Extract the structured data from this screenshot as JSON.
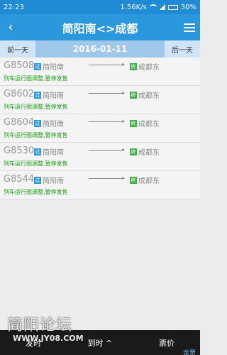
{
  "status": {
    "time": "22:23",
    "speed": "1.56K/s",
    "battery": "30%"
  },
  "header": {
    "title": "简阳南<>成都",
    "back_icon": "‹"
  },
  "date_bar": {
    "prev_label": "前一天",
    "date": "2016-01-11",
    "next_label": "后一天"
  },
  "trains": [
    {
      "code": "G8508",
      "from_badge": "过",
      "from": "简阳南",
      "to_badge": "终",
      "to": "成都东",
      "notice": "列车运行图调整,暂停发售"
    },
    {
      "code": "G8602",
      "from_badge": "过",
      "from": "简阳南",
      "to_badge": "终",
      "to": "成都东",
      "notice": "列车运行图调整,暂停发售"
    },
    {
      "code": "G8604",
      "from_badge": "过",
      "from": "简阳南",
      "to_badge": "终",
      "to": "成都东",
      "notice": "列车运行图调整,暂停发售"
    },
    {
      "code": "G8530",
      "from_badge": "过",
      "from": "简阳南",
      "to_badge": "终",
      "to": "成都东",
      "notice": "列车运行图调整,暂停发售"
    },
    {
      "code": "G8544",
      "from_badge": "过",
      "from": "简阳南",
      "to_badge": "终",
      "to": "成都东",
      "notice": "列车运行图调整,暂停发售"
    }
  ],
  "bottom": {
    "depart": "发时",
    "arrive": "到时 ^",
    "price": "票价",
    "remaining": "余票"
  },
  "watermark": {
    "text": "简阳论坛",
    "url": "WWW.JY08.COM"
  },
  "colors": {
    "header_blue": "#2b97dd",
    "status_blue": "#1f8bd4",
    "notice_green": "#1c9c18"
  }
}
